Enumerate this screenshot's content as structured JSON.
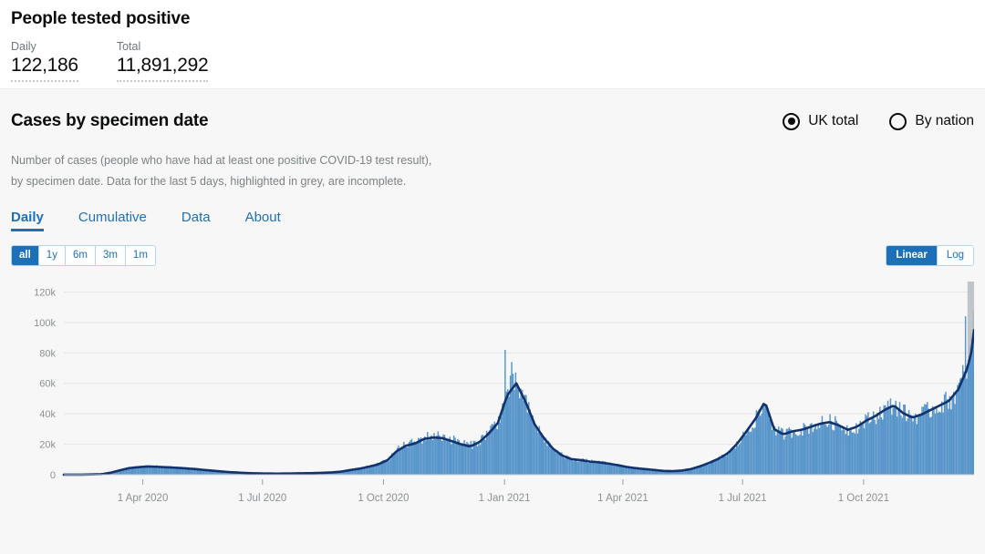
{
  "summary": {
    "title": "People tested positive",
    "metrics": [
      {
        "label": "Daily",
        "value": "122,186"
      },
      {
        "label": "Total",
        "value": "11,891,292"
      }
    ]
  },
  "section": {
    "title": "Cases by specimen date",
    "description_line1": "Number of cases (people who have had at least one positive COVID-19 test result),",
    "description_line2": "by specimen date. Data for the last 5 days, highlighted in grey, are incomplete."
  },
  "area_toggle": {
    "options": [
      {
        "label": "UK total",
        "selected": true
      },
      {
        "label": "By nation",
        "selected": false
      }
    ]
  },
  "tabs": [
    {
      "label": "Daily",
      "active": true
    },
    {
      "label": "Cumulative",
      "active": false
    },
    {
      "label": "Data",
      "active": false
    },
    {
      "label": "About",
      "active": false
    }
  ],
  "range_buttons": [
    {
      "label": "all",
      "active": true
    },
    {
      "label": "1y",
      "active": false
    },
    {
      "label": "6m",
      "active": false
    },
    {
      "label": "3m",
      "active": false
    },
    {
      "label": "1m",
      "active": false
    }
  ],
  "scale_buttons": [
    {
      "label": "Linear",
      "active": true
    },
    {
      "label": "Log",
      "active": false
    }
  ],
  "colors": {
    "bar": "#5694ca",
    "line": "#12326e",
    "accent": "#1d70b8",
    "incomplete_band": "#b8bcbe",
    "panel": "#f7f7f7"
  },
  "chart_data": {
    "type": "bar",
    "title": "Cases by specimen date",
    "xlabel": "",
    "ylabel": "",
    "grid": true,
    "legend": "none",
    "ylim": [
      0,
      128000
    ],
    "ytick_labels": [
      "0",
      "20k",
      "40k",
      "60k",
      "80k",
      "100k",
      "120k"
    ],
    "ytick_values": [
      0,
      20000,
      40000,
      60000,
      80000,
      100000,
      120000
    ],
    "xtick_labels": [
      "1 Apr 2020",
      "1 Jul 2020",
      "1 Oct 2020",
      "1 Jan 2021",
      "1 Apr 2021",
      "1 Jul 2021",
      "1 Oct 2021"
    ],
    "xtick_dates": [
      "2020-04-01",
      "2020-07-01",
      "2020-10-01",
      "2021-01-01",
      "2021-04-01",
      "2021-07-01",
      "2021-10-01"
    ],
    "x_start": "2020-02-01",
    "x_end": "2021-12-24",
    "incomplete_days": 5,
    "incomplete_note": "Data for the last 5 days, highlighted in grey, are incomplete.",
    "series": [
      {
        "name": "Daily cases",
        "type": "bar",
        "color": "#5694ca",
        "x": [
          "2020-02-01",
          "2020-02-15",
          "2020-03-01",
          "2020-03-08",
          "2020-03-15",
          "2020-03-22",
          "2020-03-29",
          "2020-04-05",
          "2020-04-12",
          "2020-04-19",
          "2020-04-26",
          "2020-05-03",
          "2020-05-10",
          "2020-05-17",
          "2020-05-24",
          "2020-05-31",
          "2020-06-07",
          "2020-06-14",
          "2020-06-21",
          "2020-06-28",
          "2020-07-05",
          "2020-07-12",
          "2020-07-19",
          "2020-07-26",
          "2020-08-02",
          "2020-08-09",
          "2020-08-16",
          "2020-08-23",
          "2020-08-30",
          "2020-09-06",
          "2020-09-13",
          "2020-09-20",
          "2020-09-27",
          "2020-10-04",
          "2020-10-11",
          "2020-10-18",
          "2020-10-25",
          "2020-11-01",
          "2020-11-08",
          "2020-11-15",
          "2020-11-22",
          "2020-11-29",
          "2020-12-06",
          "2020-12-13",
          "2020-12-20",
          "2020-12-27",
          "2021-01-03",
          "2021-01-10",
          "2021-01-17",
          "2021-01-24",
          "2021-01-31",
          "2021-02-07",
          "2021-02-14",
          "2021-02-21",
          "2021-02-28",
          "2021-03-07",
          "2021-03-14",
          "2021-03-21",
          "2021-03-28",
          "2021-04-04",
          "2021-04-11",
          "2021-04-18",
          "2021-04-25",
          "2021-05-02",
          "2021-05-09",
          "2021-05-16",
          "2021-05-23",
          "2021-05-30",
          "2021-06-06",
          "2021-06-13",
          "2021-06-20",
          "2021-06-27",
          "2021-07-04",
          "2021-07-11",
          "2021-07-18",
          "2021-07-25",
          "2021-08-01",
          "2021-08-08",
          "2021-08-15",
          "2021-08-22",
          "2021-08-29",
          "2021-09-05",
          "2021-09-12",
          "2021-09-19",
          "2021-09-26",
          "2021-10-03",
          "2021-10-10",
          "2021-10-17",
          "2021-10-24",
          "2021-10-31",
          "2021-11-07",
          "2021-11-14",
          "2021-11-21",
          "2021-11-28",
          "2021-12-05",
          "2021-12-12",
          "2021-12-19",
          "2021-12-24"
        ],
        "values": [
          20,
          60,
          400,
          1600,
          3200,
          4600,
          5200,
          5600,
          5400,
          5000,
          4700,
          4300,
          3900,
          3300,
          2700,
          2200,
          1700,
          1400,
          1100,
          900,
          800,
          750,
          800,
          900,
          1000,
          1100,
          1300,
          1600,
          2100,
          3200,
          4100,
          5500,
          7000,
          9800,
          16000,
          19500,
          21000,
          24000,
          25000,
          24500,
          22500,
          20500,
          19000,
          22000,
          28000,
          35000,
          55000,
          58000,
          45000,
          32000,
          23000,
          16000,
          12000,
          10000,
          9500,
          8500,
          8000,
          7200,
          6200,
          5000,
          4200,
          3600,
          3000,
          2400,
          2300,
          2700,
          3700,
          5500,
          7800,
          10500,
          14000,
          20000,
          28000,
          36000,
          45000,
          28000,
          26000,
          28000,
          29000,
          31000,
          33000,
          34000,
          32000,
          29000,
          31000,
          35000,
          38000,
          42000,
          45000,
          40000,
          37000,
          39000,
          42000,
          45000,
          48000,
          55000,
          72000,
          100000,
          122000
        ],
        "noise_spikes": [
          {
            "date": "2021-01-01",
            "value": 82000
          },
          {
            "date": "2021-01-06",
            "value": 74000
          },
          {
            "date": "2021-12-17",
            "value": 104000
          }
        ]
      },
      {
        "name": "7-day rolling average",
        "type": "line",
        "color": "#12326e",
        "values": [
          20,
          55,
          350,
          1400,
          3000,
          4400,
          5000,
          5400,
          5200,
          4900,
          4600,
          4200,
          3800,
          3200,
          2650,
          2150,
          1650,
          1350,
          1050,
          880,
          780,
          730,
          780,
          880,
          980,
          1080,
          1280,
          1550,
          2050,
          3100,
          4000,
          5300,
          6800,
          9500,
          15500,
          19000,
          20500,
          23500,
          24500,
          24000,
          22000,
          20000,
          18500,
          21500,
          27000,
          34000,
          52000,
          60000,
          48000,
          33000,
          24000,
          17000,
          12500,
          10200,
          9600,
          8600,
          8100,
          7300,
          6300,
          5100,
          4300,
          3700,
          3100,
          2500,
          2350,
          2750,
          3750,
          5600,
          7900,
          10600,
          14200,
          20500,
          28500,
          37000,
          48000,
          30000,
          26500,
          28500,
          29500,
          31500,
          33500,
          34500,
          32500,
          29500,
          31500,
          35500,
          38500,
          42500,
          45500,
          40500,
          37500,
          39500,
          42500,
          45500,
          48500,
          56000,
          70000,
          88000,
          95000
        ]
      }
    ]
  }
}
